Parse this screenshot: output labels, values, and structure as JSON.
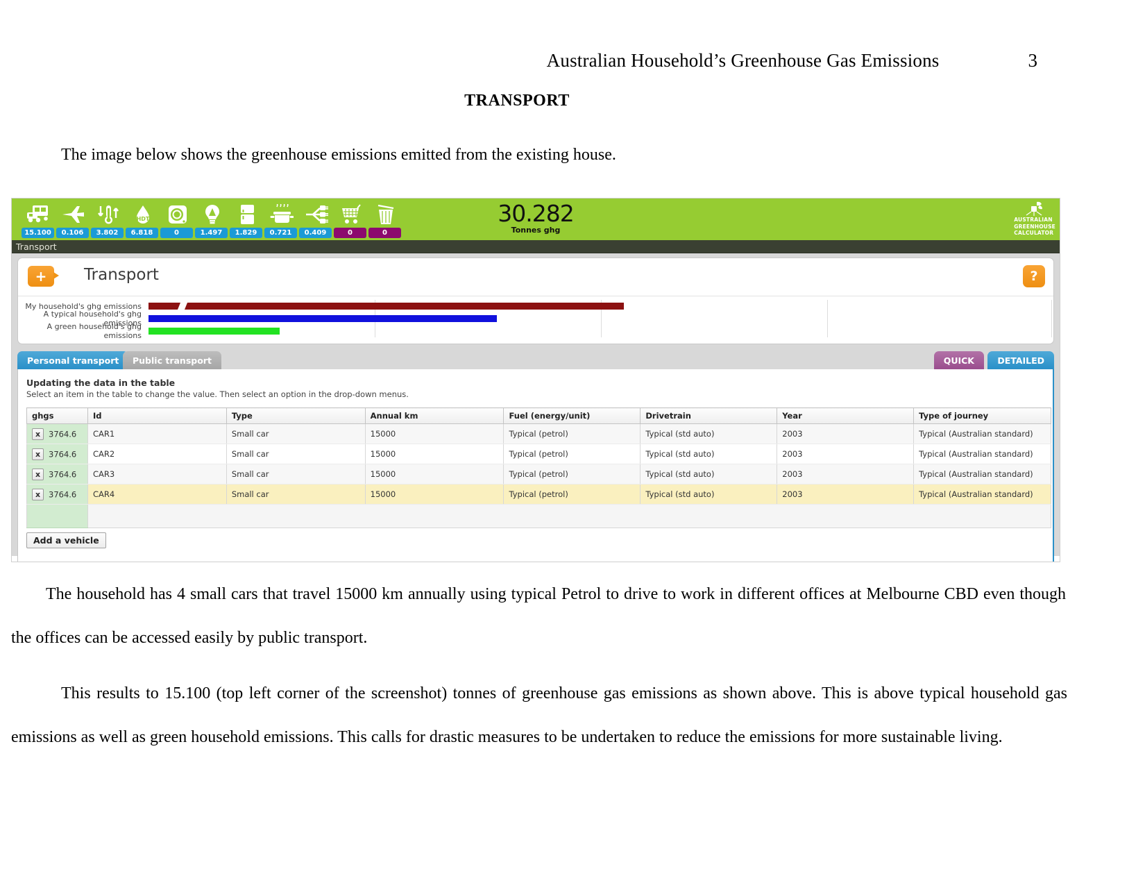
{
  "document": {
    "running_head": "Australian Household’s Greenhouse Gas Emissions",
    "page_number": "3",
    "section_heading": "TRANSPORT",
    "intro": "The image below shows the greenhouse emissions emitted from the existing house.",
    "paragraph_1": "The household has 4 small cars that travel 15000 km annually using typical Petrol to drive to work in different offices at Melbourne CBD even though the  offices can be accessed easily by public transport.",
    "paragraph_2": "This results to 15.100 (top left corner of the screenshot) tonnes of greenhouse gas emissions as shown above. This is above typical household gas emissions as well as green household emissions. This calls for drastic measures to be undertaken to reduce the emissions for more sustainable living."
  },
  "app": {
    "total": {
      "value": "30.282",
      "unit": "Tonnes ghg"
    },
    "logo": {
      "line1": "AUSTRALIAN",
      "line2": "GREENHOUSE",
      "line3": "CALCULATOR"
    },
    "categories": [
      {
        "icon": "bus-car-icon",
        "value": "15.100",
        "color": "#1b9ad6"
      },
      {
        "icon": "airplane-icon",
        "value": "0.106",
        "color": "#1b9ad6"
      },
      {
        "icon": "thermometer-icon",
        "value": "3.802",
        "color": "#1b9ad6"
      },
      {
        "icon": "water-drop-hot-icon",
        "value": "6.818",
        "color": "#1b9ad6"
      },
      {
        "icon": "washing-machine-icon",
        "value": "0",
        "color": "#1b9ad6"
      },
      {
        "icon": "lightbulb-icon",
        "value": "1.497",
        "color": "#1b9ad6"
      },
      {
        "icon": "fridge-icon",
        "value": "1.829",
        "color": "#1b9ad6"
      },
      {
        "icon": "cooking-pot-icon",
        "value": "0.721",
        "color": "#1b9ad6"
      },
      {
        "icon": "appliance-plug-icon",
        "value": "0.409",
        "color": "#1b9ad6"
      },
      {
        "icon": "shopping-trolley-icon",
        "value": "0",
        "color": "#8c0a6e"
      },
      {
        "icon": "rubbish-bin-icon",
        "value": "0",
        "color": "#8c0a6e"
      }
    ],
    "breadcrumb": "Transport",
    "panel": {
      "title": "Transport",
      "plus_label": "+",
      "help_label": "?"
    },
    "comparison_bars": [
      {
        "label": "My household's ghg emissions",
        "color": "#8c1111",
        "width_pct": 100.0
      },
      {
        "label": "A typical household's ghg emissions",
        "color": "#1111dd",
        "width_pct": 62.5
      },
      {
        "label": "A green household's ghg emissions",
        "color": "#22e222",
        "width_pct": 25.5
      }
    ],
    "tabs_left": [
      {
        "label": "Personal transport",
        "active": true
      },
      {
        "label": "Public transport",
        "active": false
      }
    ],
    "tabs_right": [
      {
        "label": "QUICK",
        "active": false
      },
      {
        "label": "DETAILED",
        "active": true
      }
    ],
    "instructions": {
      "title": "Updating the data in the table",
      "subtitle": "Select an item in the table to change the value. Then select an option in the drop-down menus."
    },
    "table": {
      "headers": [
        "ghgs",
        "Id",
        "Type",
        "Annual km",
        "Fuel (energy/unit)",
        "Drivetrain",
        "Year",
        "Type of journey"
      ],
      "delete_label": "x",
      "rows": [
        {
          "ghgs": "3764.6",
          "id": "CAR1",
          "type": "Small car",
          "annual_km": "15000",
          "fuel": "Typical (petrol)",
          "drivetrain": "Typical (std auto)",
          "year": "2003",
          "journey": "Typical (Australian standard)",
          "selected": false
        },
        {
          "ghgs": "3764.6",
          "id": "CAR2",
          "type": "Small car",
          "annual_km": "15000",
          "fuel": "Typical (petrol)",
          "drivetrain": "Typical (std auto)",
          "year": "2003",
          "journey": "Typical (Australian standard)",
          "selected": false
        },
        {
          "ghgs": "3764.6",
          "id": "CAR3",
          "type": "Small car",
          "annual_km": "15000",
          "fuel": "Typical (petrol)",
          "drivetrain": "Typical (std auto)",
          "year": "2003",
          "journey": "Typical (Australian standard)",
          "selected": false
        },
        {
          "ghgs": "3764.6",
          "id": "CAR4",
          "type": "Small car",
          "annual_km": "15000",
          "fuel": "Typical (petrol)",
          "drivetrain": "Typical (std auto)",
          "year": "2003",
          "journey": "Typical (Australian standard)",
          "selected": true
        }
      ]
    },
    "add_vehicle_label": "Add a vehicle"
  }
}
